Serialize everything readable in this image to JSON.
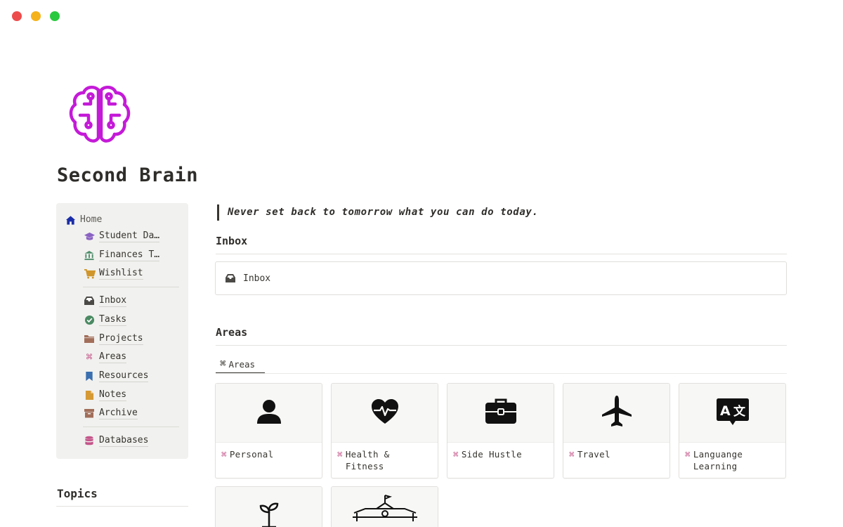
{
  "window": {
    "controls": [
      "#ed4c4c",
      "#f5b21a",
      "#29c93f"
    ]
  },
  "page": {
    "icon": "brain-icon",
    "title": "Second Brain"
  },
  "sidebar": {
    "home_label": "Home",
    "items": [
      {
        "label": "Student Da…",
        "icon": "graduation-cap-icon"
      },
      {
        "label": "Finances T…",
        "icon": "bank-icon"
      },
      {
        "label": "Wishlist",
        "icon": "cart-icon"
      },
      {
        "label": "Inbox",
        "icon": "inbox-tray-icon"
      },
      {
        "label": "Tasks",
        "icon": "check-circle-icon"
      },
      {
        "label": "Projects",
        "icon": "folder-icon"
      },
      {
        "label": "Areas",
        "icon": "command-icon"
      },
      {
        "label": "Resources",
        "icon": "bookmark-icon"
      },
      {
        "label": "Notes",
        "icon": "note-icon"
      },
      {
        "label": "Archive",
        "icon": "archive-box-icon"
      },
      {
        "label": "Databases",
        "icon": "database-icon"
      }
    ],
    "topics_heading": "Topics"
  },
  "main": {
    "quote": "Never set back to tomorrow what you can do today.",
    "inbox": {
      "heading": "Inbox",
      "link_label": "Inbox"
    },
    "areas": {
      "heading": "Areas",
      "tab_label": "Areas",
      "cards": [
        {
          "title": "Personal",
          "icon": "person-icon"
        },
        {
          "title": "Health & Fitness",
          "icon": "heart-pulse-icon"
        },
        {
          "title": "Side Hustle",
          "icon": "briefcase-icon"
        },
        {
          "title": "Travel",
          "icon": "airplane-icon"
        },
        {
          "title": "Languange Learning",
          "icon": "translate-icon"
        },
        {
          "title": "",
          "icon": "sprout-icon"
        },
        {
          "title": "",
          "icon": "school-icon"
        }
      ]
    }
  }
}
